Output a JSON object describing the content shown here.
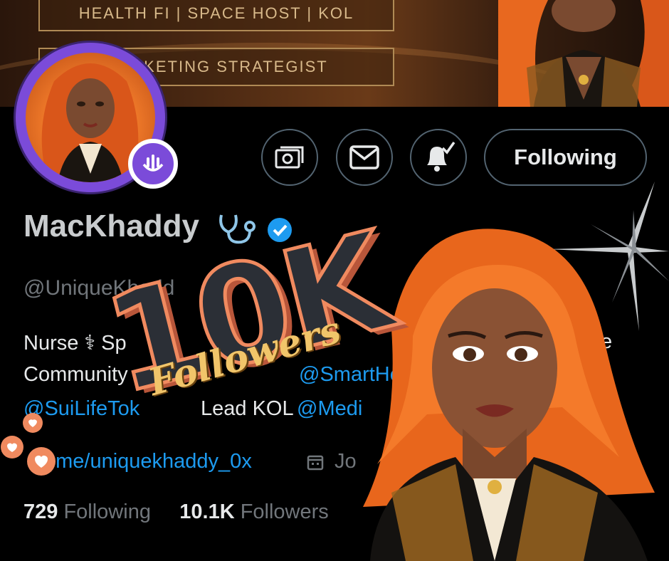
{
  "banner": {
    "tag_line_1": "HEALTH FI | SPACE HOST | KOL",
    "tag_line_2": "MARKETING STRATEGIST"
  },
  "actions": {
    "tip_icon": "money-icon",
    "message_icon": "mail-icon",
    "notify_icon": "bell-check-icon",
    "follow_label": "Following"
  },
  "profile": {
    "display_name": "MacKhaddy",
    "handle": "@UniqueKhadd",
    "bio_line1_start": "Nurse ⚕ Sp",
    "bio_line1_end": "ive",
    "bio_line2_start": "Community",
    "bio_line2_link": "@SmartHealth",
    "bio_line3_link1": "@SuiLifeTok",
    "bio_line3_text": "Lead KOL",
    "bio_line3_link2": "@Medi",
    "website": "t.me/uniquekhaddy_0x",
    "joined": "Jo"
  },
  "stats": {
    "following_count": "729",
    "following_label": "Following",
    "followers_count": "10.1K",
    "followers_label": "Followers"
  },
  "overlay": {
    "big_number": "10K",
    "script_word": "Followers"
  },
  "colors": {
    "accent_blue": "#1d9bf0",
    "spaces_purple": "#7b4bd9",
    "hair_orange": "#f07a2a",
    "badge_coral": "#f08a5f"
  }
}
